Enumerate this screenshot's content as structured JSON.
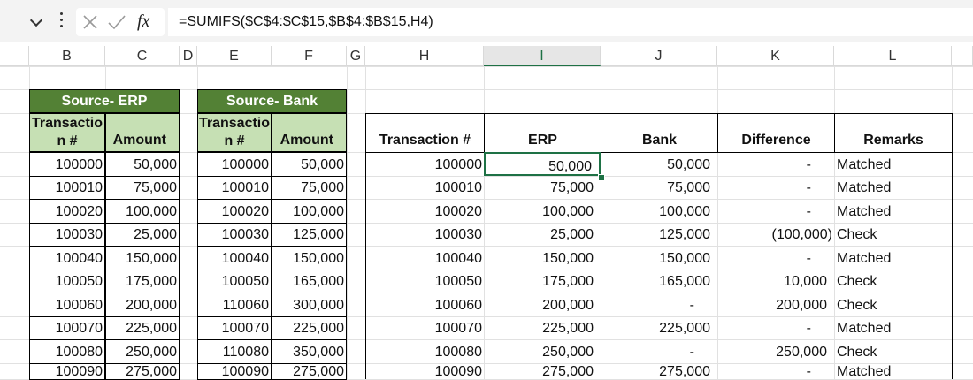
{
  "formula_bar": {
    "formula": "=SUMIFS($C$4:$C$15,$B$4:$B$15,H4)",
    "cancel_icon": "close-icon",
    "enter_icon": "check-icon",
    "function_label": "fx"
  },
  "columns": [
    "B",
    "C",
    "D",
    "E",
    "F",
    "G",
    "H",
    "I",
    "J",
    "K",
    "L"
  ],
  "erp": {
    "title": "Source- ERP",
    "col1": "Transactio\nn #",
    "col2": "Amount",
    "rows": [
      [
        "100000",
        "50,000"
      ],
      [
        "100010",
        "75,000"
      ],
      [
        "100020",
        "100,000"
      ],
      [
        "100030",
        "25,000"
      ],
      [
        "100040",
        "150,000"
      ],
      [
        "100050",
        "175,000"
      ],
      [
        "100060",
        "200,000"
      ],
      [
        "100070",
        "225,000"
      ],
      [
        "100080",
        "250,000"
      ],
      [
        "100090",
        "275,000"
      ]
    ]
  },
  "bank": {
    "title": "Source- Bank",
    "col1": "Transactio\nn #",
    "col2": "Amount",
    "rows": [
      [
        "100000",
        "50,000"
      ],
      [
        "100010",
        "75,000"
      ],
      [
        "100020",
        "100,000"
      ],
      [
        "100030",
        "125,000"
      ],
      [
        "100040",
        "150,000"
      ],
      [
        "100050",
        "165,000"
      ],
      [
        "110060",
        "300,000"
      ],
      [
        "100070",
        "225,000"
      ],
      [
        "110080",
        "350,000"
      ],
      [
        "100090",
        "275,000"
      ]
    ]
  },
  "recon": {
    "headers": [
      "Transaction #",
      "ERP",
      "Bank",
      "Difference",
      "Remarks"
    ],
    "rows": [
      [
        "100000",
        "50,000",
        "50,000",
        "-",
        "Matched"
      ],
      [
        "100010",
        "75,000",
        "75,000",
        "-",
        "Matched"
      ],
      [
        "100020",
        "100,000",
        "100,000",
        "-",
        "Matched"
      ],
      [
        "100030",
        "25,000",
        "125,000",
        "(100,000)",
        "Check"
      ],
      [
        "100040",
        "150,000",
        "150,000",
        "-",
        "Matched"
      ],
      [
        "100050",
        "175,000",
        "165,000",
        "10,000",
        "Check"
      ],
      [
        "100060",
        "200,000",
        "-",
        "200,000",
        "Check"
      ],
      [
        "100070",
        "225,000",
        "225,000",
        "-",
        "Matched"
      ],
      [
        "100080",
        "250,000",
        "-",
        "250,000",
        "Check"
      ],
      [
        "100090",
        "275,000",
        "275,000",
        "-",
        "Matched"
      ]
    ]
  },
  "colors": {
    "header_green": "#538135",
    "light_green": "#c6e0b4",
    "selection": "#1e7145"
  }
}
